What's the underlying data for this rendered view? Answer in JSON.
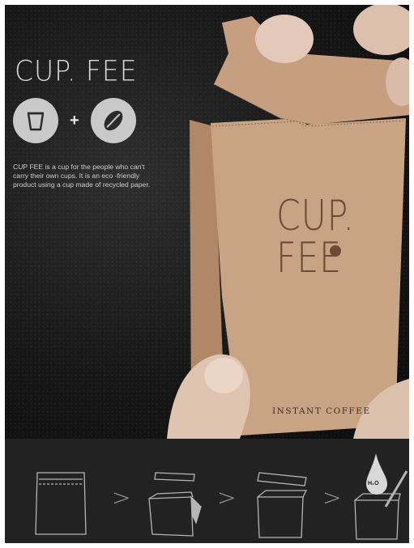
{
  "hero": {
    "title": "CUP. FEE",
    "plus": "+",
    "description": "CUP FEE is a cup for the people who can't carry their own cups. It is an eco -friendly product using a cup made of recycled paper.",
    "icons": [
      "cup-icon",
      "coffee-bean-icon"
    ]
  },
  "package": {
    "brand": "CUP.\nFEE",
    "label": "INSTANT COFFEE",
    "color": "#c9a484"
  },
  "instructions": {
    "arrows": [
      ">",
      ">",
      ">"
    ],
    "water_label": "H₂O",
    "steps": [
      "sealed-package-icon",
      "tear-open-icon",
      "open-cup-icon",
      "pour-water-icon"
    ]
  }
}
